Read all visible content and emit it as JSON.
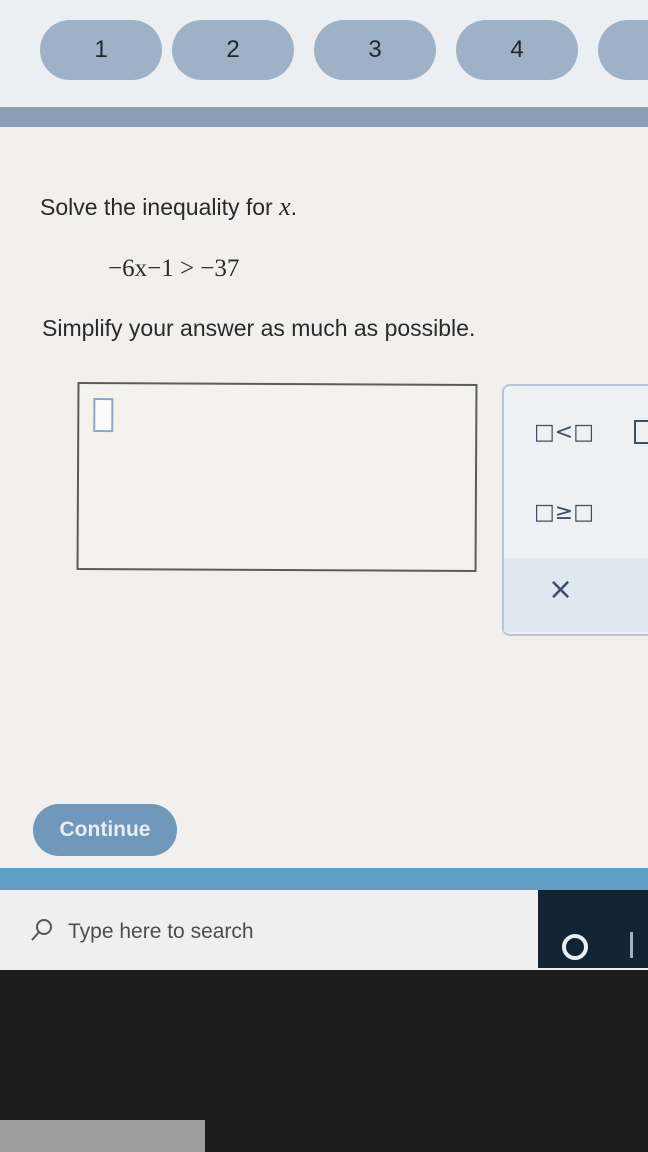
{
  "steps": [
    "1",
    "2",
    "3",
    "4"
  ],
  "question": {
    "prompt_prefix": "Solve the inequality for ",
    "variable": "x",
    "prompt_suffix": ".",
    "inequality": "−6x−1 > −37",
    "instruction": "Simplify your answer as much as possible."
  },
  "palette": {
    "less_than": "□<□",
    "greater_equal": "□≥□",
    "clear": "×"
  },
  "continue_label": "Continue",
  "taskbar": {
    "search_placeholder": "Type here to search"
  },
  "colors": {
    "accent": "#6f98bb",
    "taskbar": "#122334",
    "step_pill": "#9db2c6"
  }
}
